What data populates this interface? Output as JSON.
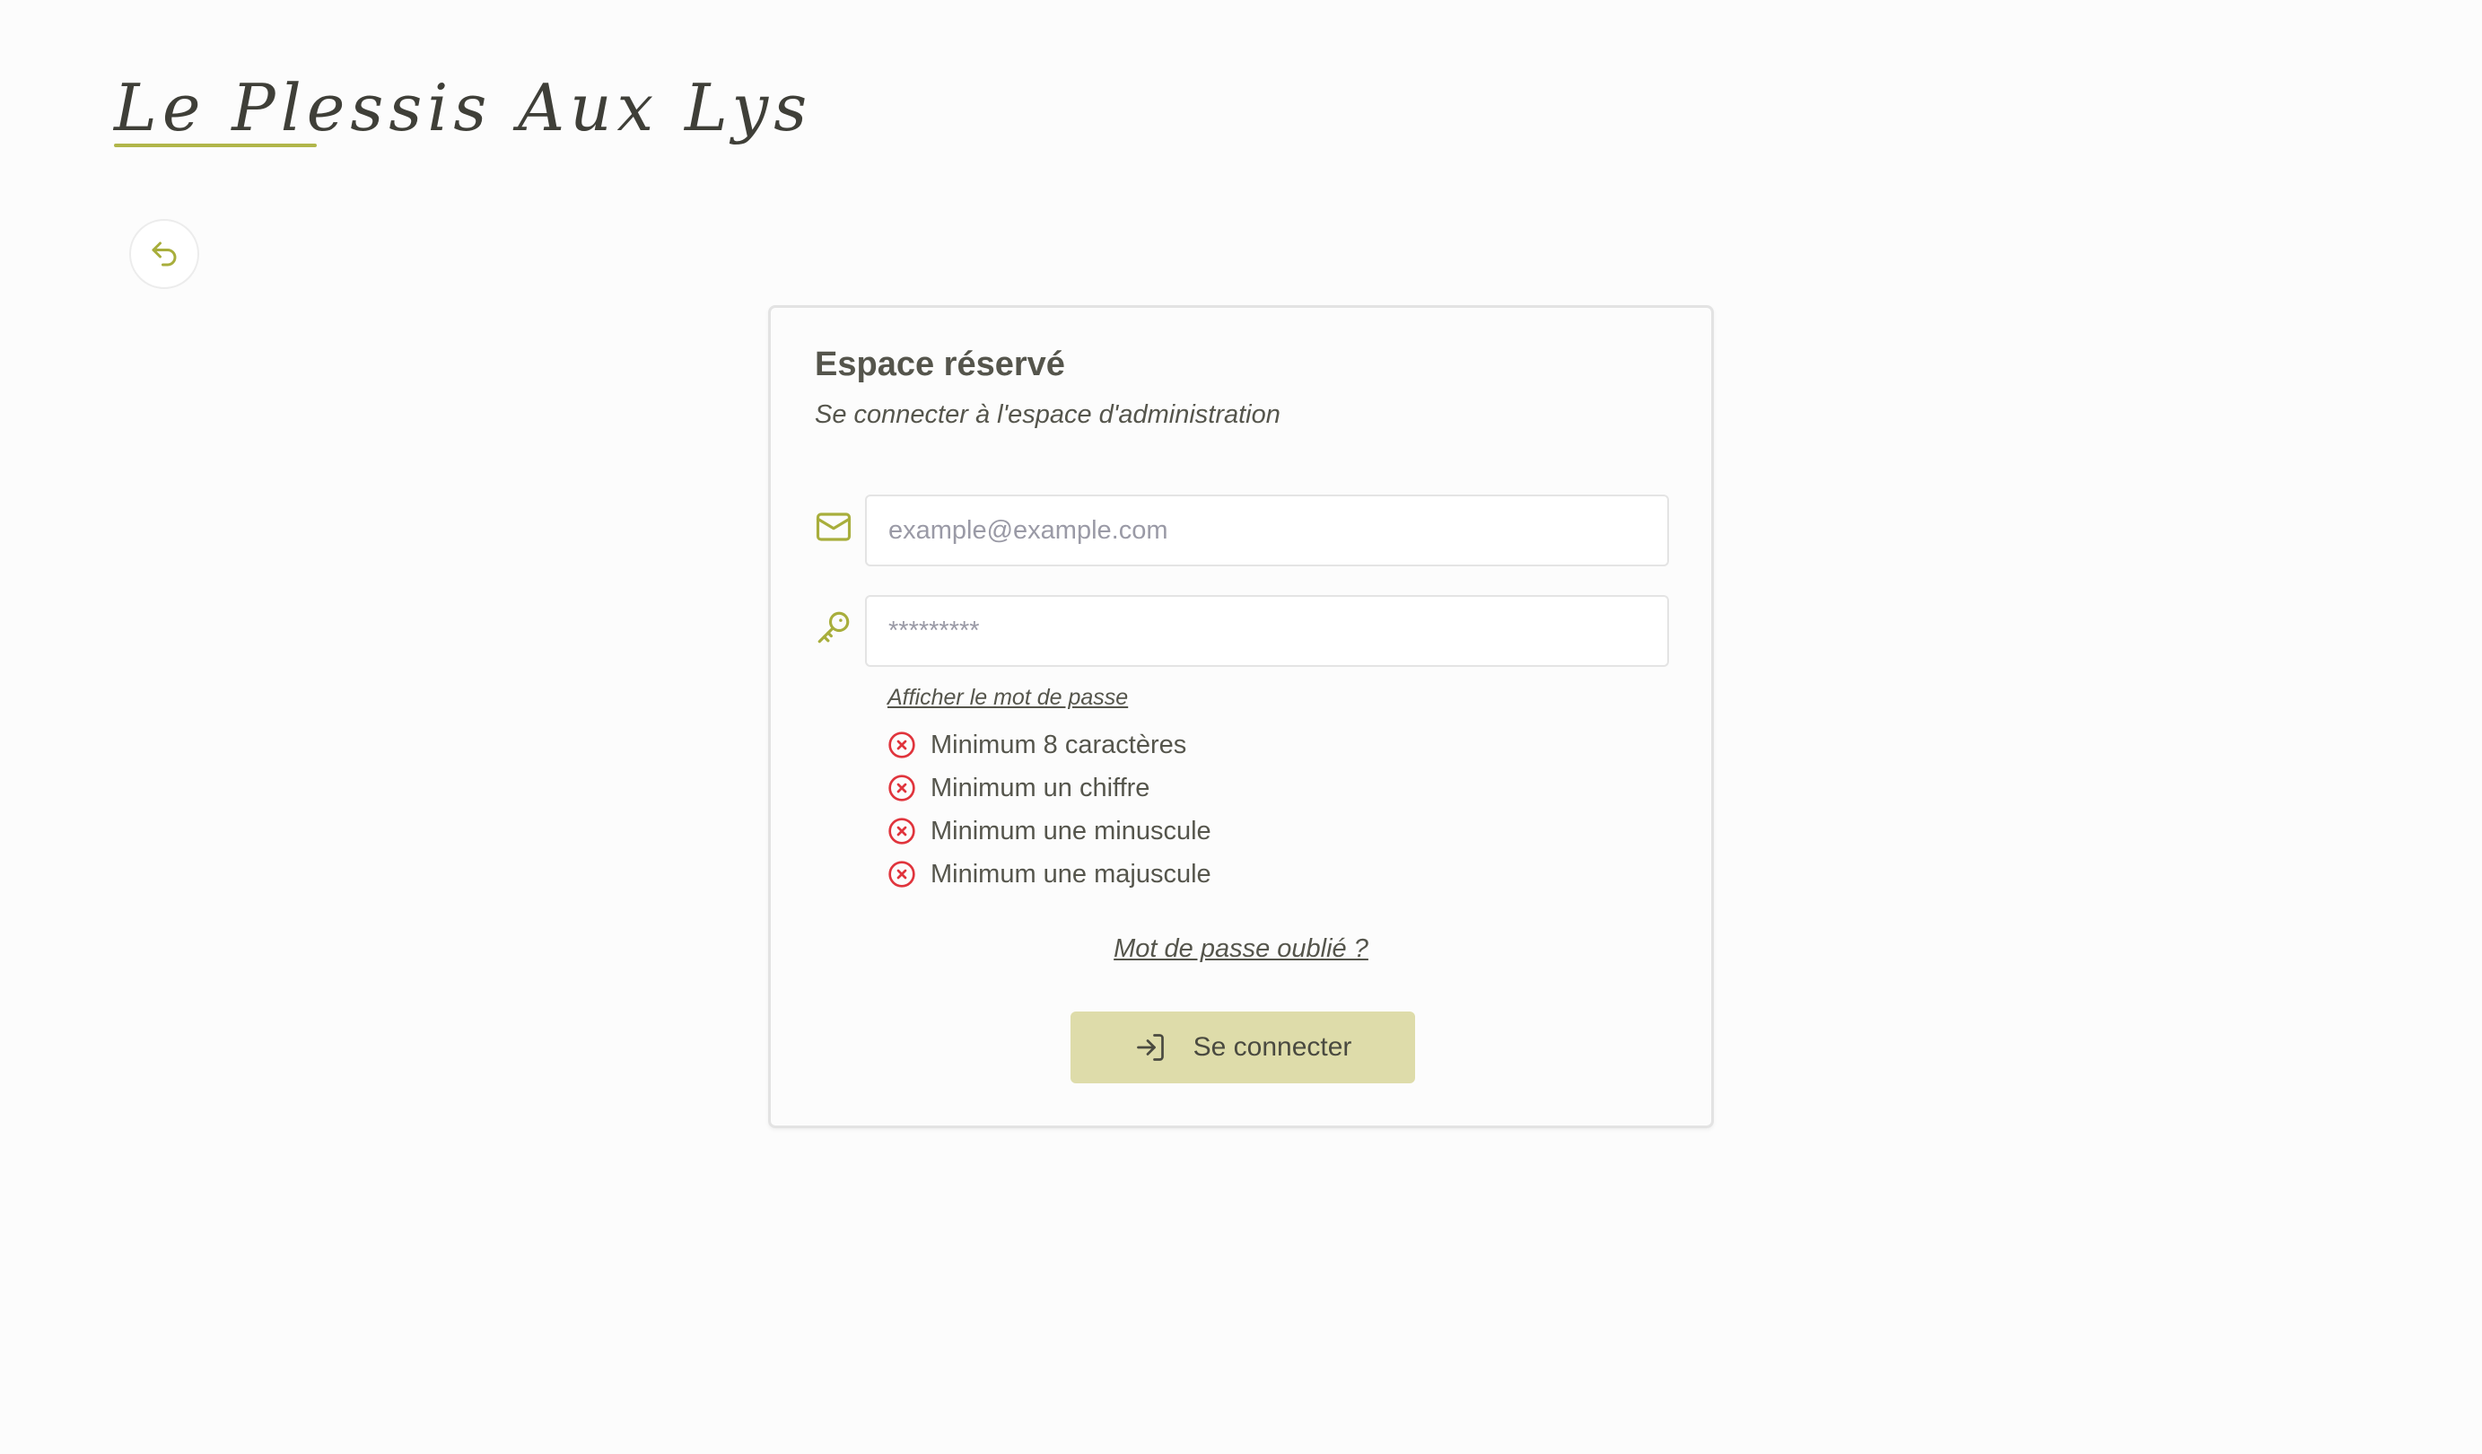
{
  "brand": {
    "name": "Le Plessis Aux Lys"
  },
  "nav": {
    "back_icon": "undo-arrow-icon"
  },
  "login": {
    "title": "Espace réservé",
    "subtitle": "Se connecter à l'espace d'administration",
    "email": {
      "icon": "mail-icon",
      "value": "",
      "placeholder": "example@example.com"
    },
    "password": {
      "icon": "key-icon",
      "value": "",
      "placeholder": "*********"
    },
    "show_password_label": "Afficher le mot de passe",
    "rules": [
      {
        "label": "Minimum 8 caractères",
        "status": "invalid"
      },
      {
        "label": "Minimum un chiffre",
        "status": "invalid"
      },
      {
        "label": "Minimum une minuscule",
        "status": "invalid"
      },
      {
        "label": "Minimum une majuscule",
        "status": "invalid"
      }
    ],
    "forgot_password_label": "Mot de passe oublié ?",
    "submit_label": "Se connecter",
    "submit_icon": "login-icon"
  },
  "colors": {
    "accent": "#b1b64a",
    "button_bg": "#dedcaa",
    "error": "#e0343c",
    "text": "#55554c"
  }
}
